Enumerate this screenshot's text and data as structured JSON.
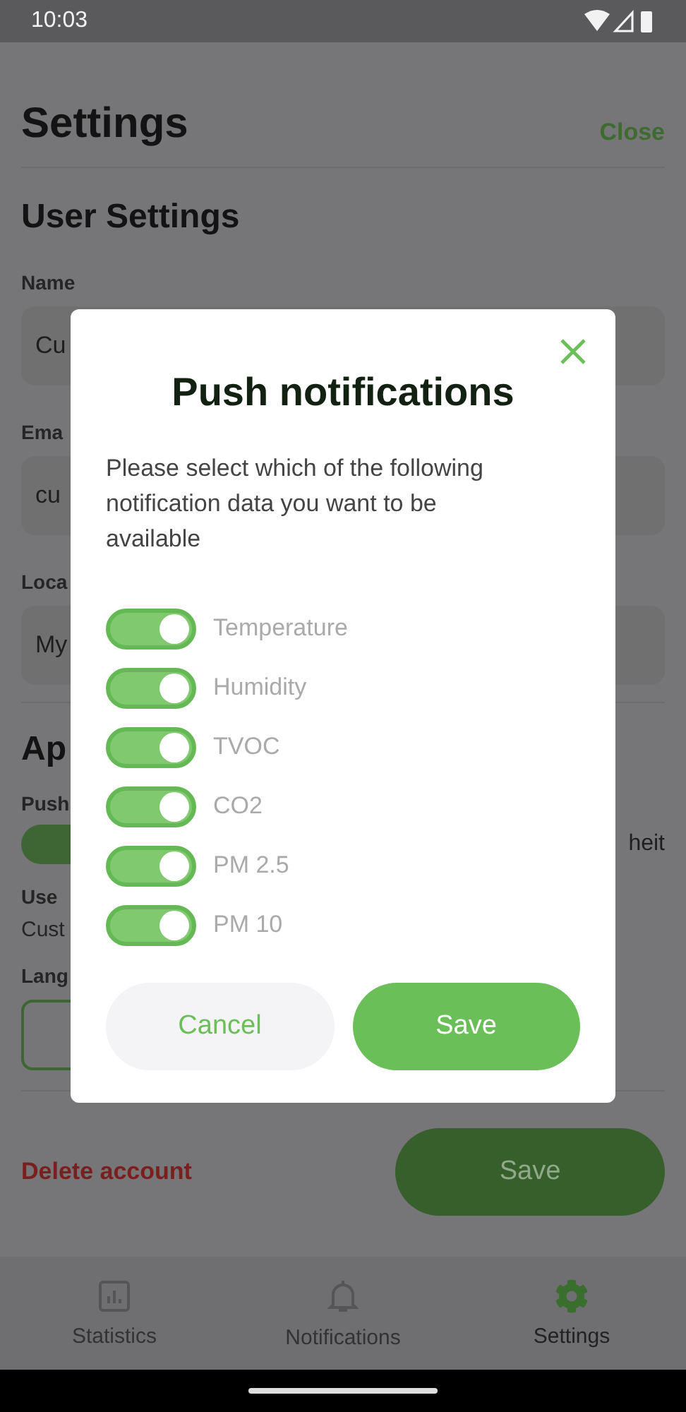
{
  "status_bar": {
    "time": "10:03"
  },
  "page": {
    "title": "Settings",
    "close": "Close",
    "section_title": "User Settings",
    "fields": [
      {
        "label": "Name",
        "value": "Cu"
      },
      {
        "label": "Ema",
        "value": "cu"
      },
      {
        "label": "Loca",
        "value": "My"
      }
    ],
    "app_section_title": "Ap",
    "push_label": "Push",
    "unit_option": "heit",
    "user_label": "Use",
    "user_value": "Cust",
    "language_label": "Lang",
    "delete_account": "Delete account",
    "save": "Save"
  },
  "bottom_nav": [
    {
      "label": "Statistics",
      "kind": "chart",
      "selected": false
    },
    {
      "label": "Notifications",
      "kind": "bell",
      "selected": false
    },
    {
      "label": "Settings",
      "kind": "gear",
      "selected": true
    }
  ],
  "dialog": {
    "title": "Push notifications",
    "description": "Please select which of the following notification data you want to be available",
    "toggles": [
      {
        "label": "Temperature",
        "on": true
      },
      {
        "label": "Humidity",
        "on": true
      },
      {
        "label": "TVOC",
        "on": true
      },
      {
        "label": "CO2",
        "on": true
      },
      {
        "label": "PM 2.5",
        "on": true
      },
      {
        "label": "PM 10",
        "on": true
      }
    ],
    "cancel": "Cancel",
    "save": "Save"
  }
}
